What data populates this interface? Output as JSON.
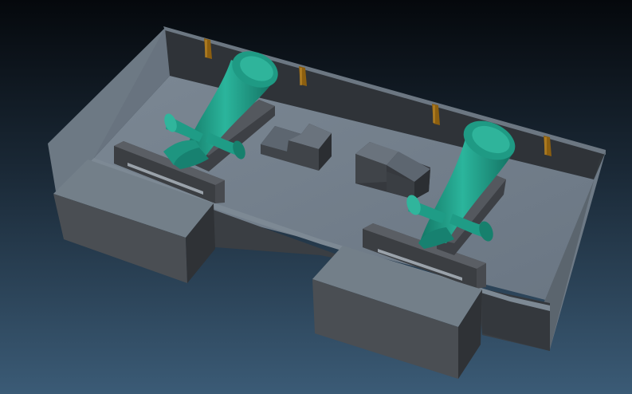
{
  "scene": {
    "background_top": "#05080c",
    "background_bottom": "#3b5b76",
    "wall_light": "#6f7b86",
    "wall_dark": "#32363b",
    "floor": "#737f8b",
    "block_top": "#737f89",
    "block_front": "#4b4f54",
    "block_side": "#2f3236",
    "rail_color": "#46494d",
    "horn_color": "#22a38d",
    "horn_highlight": "#38c2a8",
    "horn_shadow": "#137866",
    "marker_color": "#9b6a12",
    "objects": [
      "outer-enclosure",
      "front-left-block",
      "front-right-block",
      "center-left-step-block",
      "center-right-step-block",
      "left-rail",
      "right-rail",
      "left-horn-antenna",
      "right-horn-antenna",
      "wall-markers"
    ]
  }
}
